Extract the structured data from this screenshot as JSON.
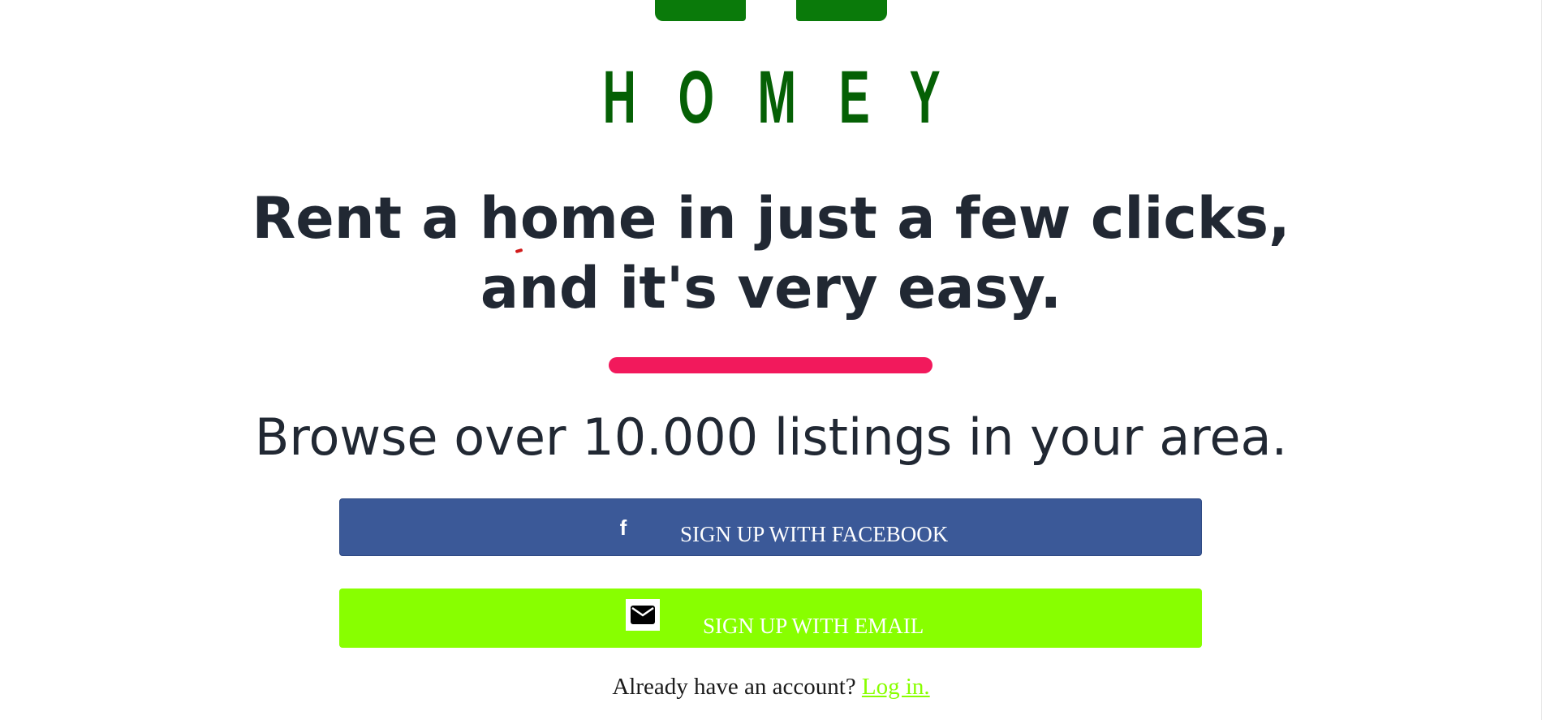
{
  "brand": {
    "letters": [
      "H",
      "O",
      "M",
      "E",
      "Y"
    ],
    "color": "#056005",
    "logo_color": "#0a7a0a"
  },
  "hero": {
    "headline_line1": "Rent a home in just a few clicks,",
    "headline_line2": "and it's very easy.",
    "headline_color": "#212833",
    "divider_color": "#f2195c",
    "subheading": "Browse over 10.000 listings in your area."
  },
  "actions": {
    "facebook": {
      "label": "SIGN UP WITH FACEBOOK",
      "icon": "facebook-icon",
      "icon_glyph": "f",
      "color": "#3b5998"
    },
    "email": {
      "label": "SIGN UP WITH EMAIL",
      "icon": "envelope-icon",
      "color": "#88ff00"
    }
  },
  "login": {
    "prompt": "Already have an account?",
    "link_text": "Log in.",
    "link_color": "#88ff00"
  }
}
